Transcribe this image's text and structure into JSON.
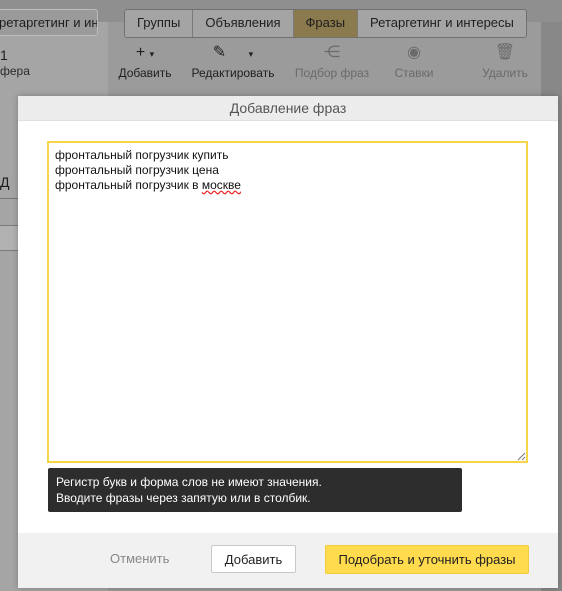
{
  "background": {
    "left_tab_label": "ретаргетинг и интересы",
    "left_number": "1",
    "left_sub": "фера",
    "left_letter": "Д",
    "tabs": [
      {
        "label": "Группы",
        "active": false
      },
      {
        "label": "Объявления",
        "active": false
      },
      {
        "label": "Фразы",
        "active": true
      },
      {
        "label": "Ретаргетинг и интересы",
        "active": false
      }
    ],
    "toolbar": {
      "add_label": "Добавить",
      "edit_label": "Редактировать",
      "pick_label": "Подбор фраз",
      "bids_label": "Ставки",
      "delete_label": "Удалить"
    }
  },
  "modal": {
    "title": "Добавление фраз",
    "phrases": [
      "фронтальный погрузчик купить",
      "фронтальный погрузчик цена",
      "фронтальный погрузчик в москве"
    ],
    "phrase3_prefix": "фронтальный погрузчик в ",
    "phrase3_misspelled": "москве",
    "hint_line1": "Регистр букв и форма слов не имеют значения.",
    "hint_line2": "Вводите фразы через запятую или в столбик.",
    "buttons": {
      "cancel": "Отменить",
      "add": "Добавить",
      "pick": "Подобрать и уточнить фразы"
    }
  },
  "colors": {
    "accent_yellow": "#ffdb4d",
    "textarea_border": "#f6d54a",
    "hint_bg": "#2d2d2d",
    "active_tab": "#8a7a4e"
  },
  "icons": {
    "add": "plus-icon",
    "edit": "pencil-icon",
    "pick": "nodes-icon",
    "bids": "coin-icon",
    "delete": "trash-icon"
  }
}
